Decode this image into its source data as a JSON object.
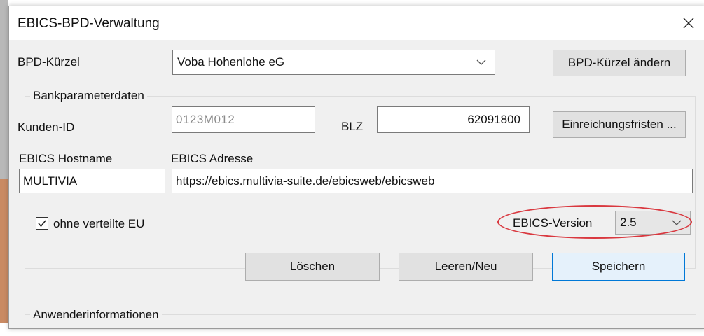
{
  "window": {
    "title": "EBICS-BPD-Verwaltung",
    "close_icon": "close-icon"
  },
  "bpd": {
    "label": "BPD-Kürzel",
    "selected": "Voba Hohenlohe eG",
    "change_button": "BPD-Kürzel ändern"
  },
  "bank_params": {
    "group_title": "Bankparameterdaten",
    "customer_id_label": "Kunden-ID",
    "customer_id_value": "0123M012",
    "blz_label": "BLZ",
    "blz_value": "62091800",
    "deadlines_button": "Einreichungsfristen ...",
    "hostname_label": "EBICS Hostname",
    "hostname_value": "MULTIVIA",
    "address_label": "EBICS Adresse",
    "address_value": "https://ebics.multivia-suite.de/ebicsweb/ebicsweb",
    "checkbox_label": "ohne verteilte EU",
    "checkbox_checked": true,
    "version_label": "EBICS-Version",
    "version_value": "2.5"
  },
  "actions": {
    "delete": "Löschen",
    "clear_new": "Leeren/Neu",
    "save": "Speichern"
  },
  "user_info": {
    "group_title": "Anwenderinformationen"
  },
  "colors": {
    "accent": "#0078d7",
    "highlight": "#d9383f",
    "window_bg": "#f0f0f0"
  }
}
